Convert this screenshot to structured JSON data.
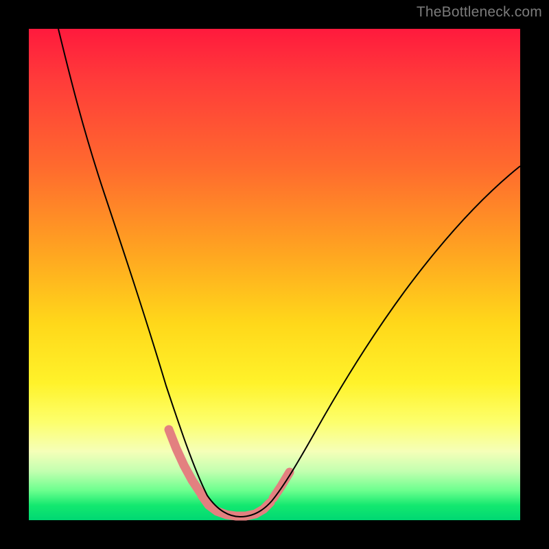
{
  "watermark": "TheBottleneck.com",
  "colors": {
    "page_bg": "#000000",
    "gradient_top": "#ff1a3d",
    "gradient_mid1": "#ffa321",
    "gradient_mid2": "#fff22a",
    "gradient_bottom": "#00d873",
    "curve_thin": "#000000",
    "curve_thick": "#e38080"
  },
  "chart_data": {
    "type": "line",
    "title": "",
    "xlabel": "",
    "ylabel": "",
    "xlim": [
      0,
      100
    ],
    "ylim": [
      0,
      100
    ],
    "series": [
      {
        "name": "bottleneck-curve",
        "x": [
          6,
          10,
          15,
          20,
          25,
          28,
          30,
          32,
          34,
          36,
          38,
          40,
          42,
          44,
          46,
          48,
          52,
          58,
          66,
          76,
          88,
          100
        ],
        "values": [
          100,
          85,
          68,
          52,
          36,
          26,
          19,
          13,
          8,
          4,
          2,
          1,
          1,
          1,
          2,
          4,
          9,
          17,
          28,
          42,
          57,
          72
        ]
      }
    ],
    "highlight_segments": [
      {
        "x_start": 29,
        "x_end": 34,
        "note": "left descending thick band"
      },
      {
        "x_start": 35,
        "x_end": 46,
        "note": "valley thick band"
      },
      {
        "x_start": 48,
        "x_end": 52,
        "note": "right ascending thick band"
      }
    ],
    "notes": "V-shaped curve with minimum around x≈41; background gradient encodes bottleneck severity (red high → green low). Values read approximately from pixel positions; no numeric axis labels present."
  }
}
